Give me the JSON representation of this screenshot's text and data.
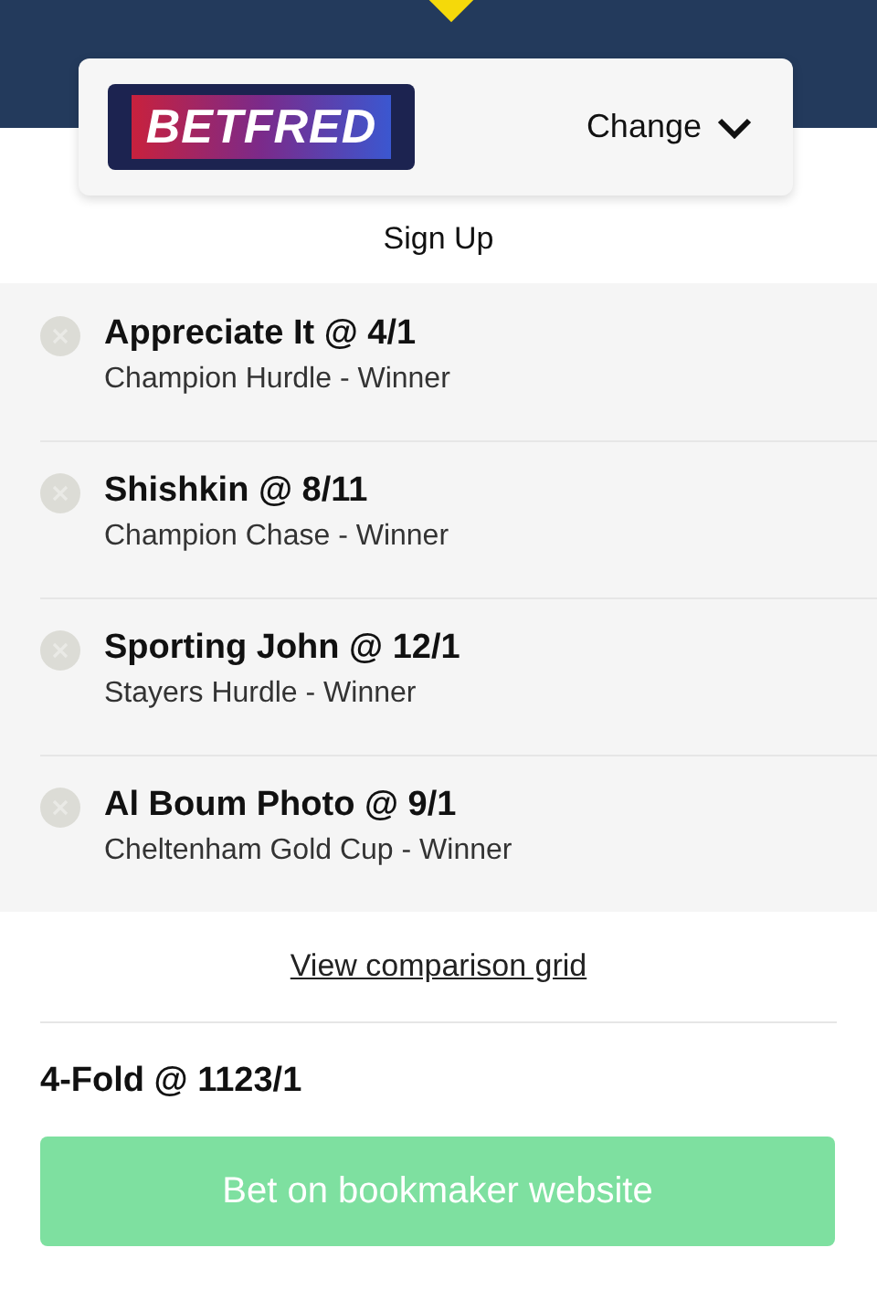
{
  "bookmaker": {
    "logo": "BETFRED",
    "change_label": "Change"
  },
  "sign_up": "Sign Up",
  "selections": [
    {
      "title": "Appreciate It @ 4/1",
      "market": "Champion Hurdle - Winner"
    },
    {
      "title": "Shishkin @ 8/11",
      "market": "Champion Chase - Winner"
    },
    {
      "title": "Sporting John @ 12/1",
      "market": "Stayers Hurdle - Winner"
    },
    {
      "title": "Al Boum Photo @ 9/1",
      "market": "Cheltenham Gold Cup - Winner"
    }
  ],
  "comparison_link": "View comparison grid",
  "accumulator": "4-Fold @ 1123/1",
  "bet_button": {
    "label": "Bet on bookmaker website",
    "disabled": true
  }
}
